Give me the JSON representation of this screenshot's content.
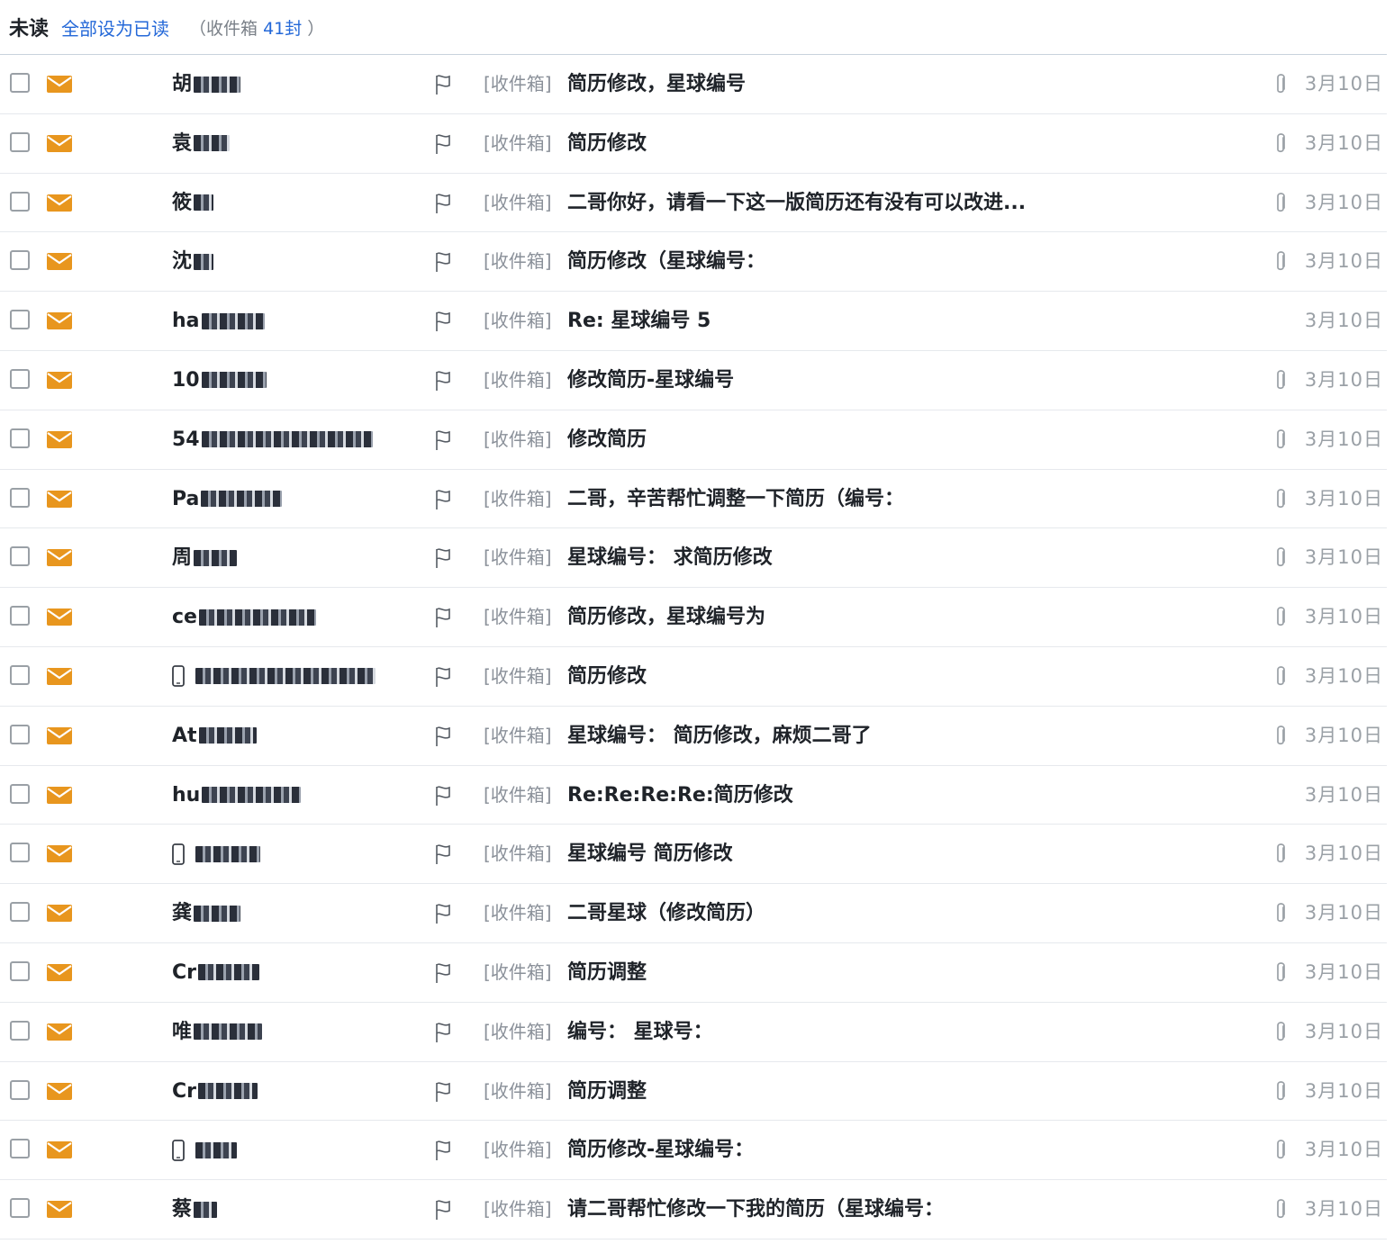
{
  "header": {
    "title": "未读",
    "mark_all_read": "全部设为已读",
    "count_prefix": "（收件箱 ",
    "count_value": "41封",
    "count_suffix": " ）"
  },
  "colors": {
    "accent": "#2468d8",
    "envelope": "#e8961e",
    "muted": "#9aa0a6"
  },
  "icons": {
    "checkbox": "checkbox-icon",
    "envelope": "envelope-icon",
    "flag": "flag-icon",
    "attachment": "paperclip-icon",
    "phone": "phone-icon"
  },
  "emails": [
    {
      "sender": "胡",
      "phone": false,
      "folder": "[收件箱]",
      "subject": "简历修改，星球编号",
      "attachment": true,
      "date": "3月10日"
    },
    {
      "sender": "袁",
      "phone": false,
      "folder": "[收件箱]",
      "subject": "简历修改",
      "attachment": true,
      "date": "3月10日"
    },
    {
      "sender": "筱",
      "phone": false,
      "folder": "[收件箱]",
      "subject": "二哥你好，请看一下这一版简历还有没有可以改进...",
      "attachment": true,
      "date": "3月10日"
    },
    {
      "sender": "沈",
      "phone": false,
      "folder": "[收件箱]",
      "subject": "简历修改（星球编号：",
      "attachment": true,
      "date": "3月10日"
    },
    {
      "sender": "ha",
      "phone": false,
      "folder": "[收件箱]",
      "subject": "Re: 星球编号 5",
      "attachment": false,
      "date": "3月10日"
    },
    {
      "sender": "10",
      "phone": false,
      "folder": "[收件箱]",
      "subject": "修改简历-星球编号",
      "attachment": true,
      "date": "3月10日"
    },
    {
      "sender": "54",
      "phone": false,
      "folder": "[收件箱]",
      "subject": "修改简历",
      "attachment": true,
      "date": "3月10日"
    },
    {
      "sender": "Pa",
      "phone": false,
      "folder": "[收件箱]",
      "subject": "二哥，辛苦帮忙调整一下简历（编号：",
      "attachment": true,
      "date": "3月10日"
    },
    {
      "sender": "周",
      "phone": false,
      "folder": "[收件箱]",
      "subject": "星球编号： 求简历修改",
      "attachment": true,
      "date": "3月10日"
    },
    {
      "sender": "ce",
      "phone": false,
      "folder": "[收件箱]",
      "subject": "简历修改，星球编号为",
      "attachment": true,
      "date": "3月10日"
    },
    {
      "sender": "",
      "phone": true,
      "folder": "[收件箱]",
      "subject": "简历修改",
      "attachment": true,
      "date": "3月10日"
    },
    {
      "sender": "At",
      "phone": false,
      "folder": "[收件箱]",
      "subject": "星球编号： 简历修改，麻烦二哥了",
      "attachment": true,
      "date": "3月10日"
    },
    {
      "sender": "hu",
      "phone": false,
      "folder": "[收件箱]",
      "subject": "Re:Re:Re:Re:简历修改",
      "attachment": false,
      "date": "3月10日"
    },
    {
      "sender": "",
      "phone": true,
      "folder": "[收件箱]",
      "subject": "星球编号 简历修改",
      "attachment": true,
      "date": "3月10日"
    },
    {
      "sender": "龚",
      "phone": false,
      "folder": "[收件箱]",
      "subject": "二哥星球（修改简历）",
      "attachment": true,
      "date": "3月10日"
    },
    {
      "sender": "Cr",
      "phone": false,
      "folder": "[收件箱]",
      "subject": "简历调整",
      "attachment": true,
      "date": "3月10日"
    },
    {
      "sender": "唯",
      "phone": false,
      "folder": "[收件箱]",
      "subject": "编号： 星球号：",
      "attachment": true,
      "date": "3月10日"
    },
    {
      "sender": "Cr",
      "phone": false,
      "folder": "[收件箱]",
      "subject": "简历调整",
      "attachment": true,
      "date": "3月10日"
    },
    {
      "sender": "",
      "phone": true,
      "folder": "[收件箱]",
      "subject": "简历修改-星球编号：",
      "attachment": true,
      "date": "3月10日"
    },
    {
      "sender": "蔡",
      "phone": false,
      "folder": "[收件箱]",
      "subject": "请二哥帮忙修改一下我的简历（星球编号：",
      "attachment": true,
      "date": "3月10日"
    }
  ]
}
